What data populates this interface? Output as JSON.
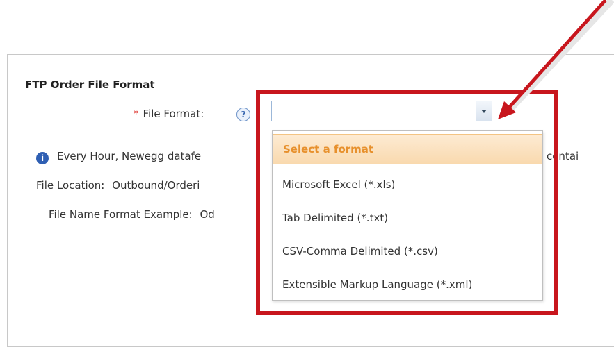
{
  "section": {
    "title": "FTP Order File Format"
  },
  "file_format": {
    "required_mark": "*",
    "label": "File Format:",
    "help_icon": "question-icon",
    "value": ""
  },
  "info": {
    "icon": "info-icon",
    "text": "Every Hour, Newegg datafe",
    "tail": "contai",
    "file_location_label": "File Location:",
    "file_location_value": "Outbound/Order",
    "file_location_fragment": "i",
    "file_name_label": "File Name Format Example:",
    "file_name_value": "Od"
  },
  "dropdown": {
    "options": [
      {
        "label": "Select a format",
        "selected": true
      },
      {
        "label": "Microsoft Excel (*.xls)",
        "selected": false
      },
      {
        "label": "Tab Delimited (*.txt)",
        "selected": false
      },
      {
        "label": "CSV-Comma Delimited (*.csv)",
        "selected": false
      },
      {
        "label": "Extensible Markup Language (*.xml)",
        "selected": false
      }
    ]
  },
  "annotation": {
    "color": "#c8161d",
    "shape": "red-arrow-and-box"
  }
}
